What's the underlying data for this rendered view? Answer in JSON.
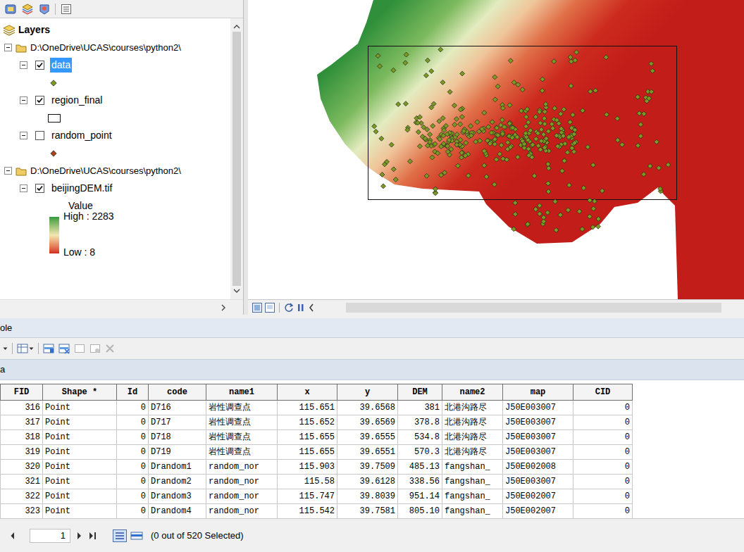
{
  "toc": {
    "title": "Layers",
    "groups": [
      {
        "path": "D:\\OneDrive\\UCAS\\courses\\python2\\",
        "expanded": true,
        "layers": [
          {
            "name": "data",
            "checked": true,
            "selected": true,
            "expanded": true,
            "kind": "point",
            "color": "#7a9a22"
          },
          {
            "name": "region_final",
            "checked": true,
            "selected": false,
            "expanded": true,
            "kind": "polygon"
          },
          {
            "name": "random_point",
            "checked": false,
            "selected": false,
            "expanded": true,
            "kind": "point",
            "color": "#a8441c"
          }
        ]
      },
      {
        "path": "D:\\OneDrive\\UCAS\\courses\\python2\\",
        "expanded": true,
        "layers": [
          {
            "name": "beijingDEM.tif",
            "checked": true,
            "selected": false,
            "expanded": true,
            "kind": "raster",
            "legend": {
              "field": "Value",
              "high": "High : 2283",
              "low": "Low : 8"
            }
          }
        ]
      }
    ]
  },
  "table": {
    "title": "ole",
    "tab": "a",
    "columns": [
      "FID",
      "Shape *",
      "Id",
      "code",
      "name1",
      "x",
      "y",
      "DEM",
      "name2",
      "map",
      "CID"
    ],
    "rows": [
      [
        "316",
        "Point",
        "0",
        "D716",
        "岩性调查点",
        "115.651",
        "39.6568",
        "381",
        "北港沟路尽",
        "J50E003007",
        "0"
      ],
      [
        "317",
        "Point",
        "0",
        "D717",
        "岩性调查点",
        "115.652",
        "39.6569",
        "378.8",
        "北港沟路尽",
        "J50E003007",
        "0"
      ],
      [
        "318",
        "Point",
        "0",
        "D718",
        "岩性调查点",
        "115.655",
        "39.6555",
        "534.8",
        "北港沟路尽",
        "J50E003007",
        "0"
      ],
      [
        "319",
        "Point",
        "0",
        "D719",
        "岩性调查点",
        "115.655",
        "39.6551",
        "570.3",
        "北港沟路尽",
        "J50E003007",
        "0"
      ],
      [
        "320",
        "Point",
        "0",
        "Drandom1",
        "random_nor",
        "115.903",
        "39.7509",
        "485.13",
        "fangshan_",
        "J50E002008",
        "0"
      ],
      [
        "321",
        "Point",
        "0",
        "Drandom2",
        "random_nor",
        "115.58",
        "39.6128",
        "338.56",
        "fangshan_",
        "J50E003007",
        "0"
      ],
      [
        "322",
        "Point",
        "0",
        "Drandom3",
        "random_nor",
        "115.747",
        "39.8039",
        "951.14",
        "fangshan_",
        "J50E002007",
        "0"
      ],
      [
        "323",
        "Point",
        "0",
        "Drandom4",
        "random_nor",
        "115.542",
        "39.7581",
        "805.10",
        "fangshan_",
        "J50E002007",
        "0"
      ]
    ],
    "page": "1",
    "status": "(0 out of 520 Selected)"
  }
}
